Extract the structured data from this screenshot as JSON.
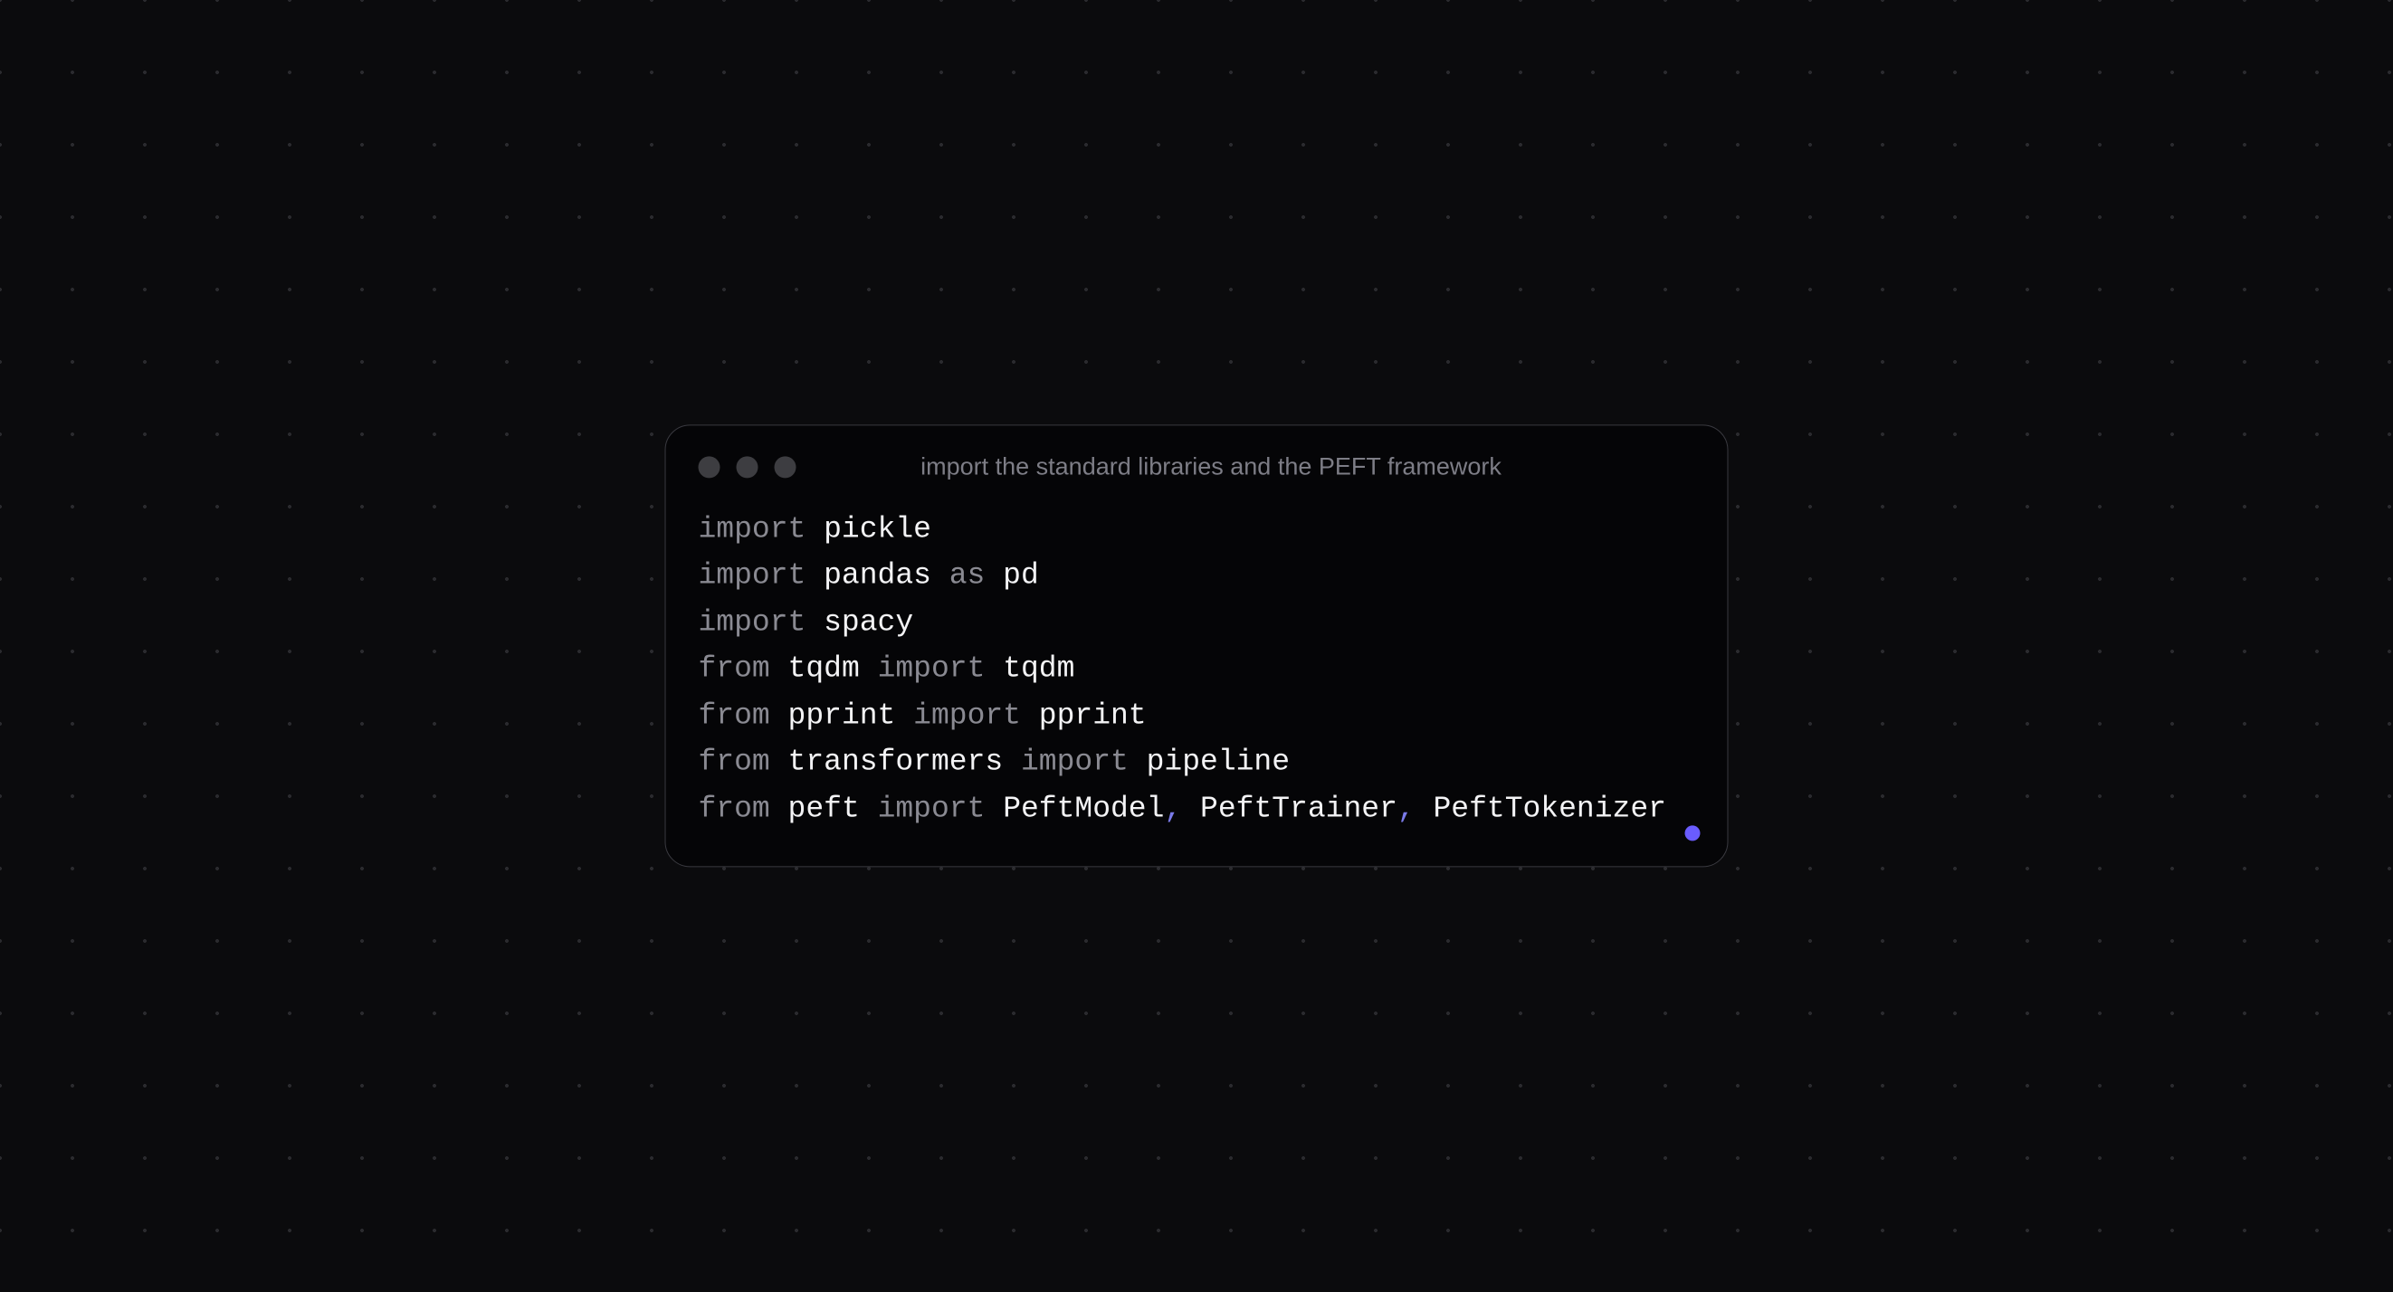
{
  "window": {
    "title": "import the standard libraries and the PEFT framework"
  },
  "code": {
    "lines": [
      [
        {
          "t": "import ",
          "c": "kw"
        },
        {
          "t": "pickle",
          "c": "id"
        }
      ],
      [
        {
          "t": "import ",
          "c": "kw"
        },
        {
          "t": "pandas ",
          "c": "id"
        },
        {
          "t": "as ",
          "c": "kw"
        },
        {
          "t": "pd",
          "c": "id"
        }
      ],
      [
        {
          "t": "import ",
          "c": "kw"
        },
        {
          "t": "spacy",
          "c": "id"
        }
      ],
      [
        {
          "t": "from ",
          "c": "kw"
        },
        {
          "t": "tqdm ",
          "c": "id"
        },
        {
          "t": "import ",
          "c": "kw"
        },
        {
          "t": "tqdm",
          "c": "id"
        }
      ],
      [
        {
          "t": "from ",
          "c": "kw"
        },
        {
          "t": "pprint ",
          "c": "id"
        },
        {
          "t": "import ",
          "c": "kw"
        },
        {
          "t": "pprint",
          "c": "id"
        }
      ],
      [
        {
          "t": "from ",
          "c": "kw"
        },
        {
          "t": "transformers ",
          "c": "id"
        },
        {
          "t": "import ",
          "c": "kw"
        },
        {
          "t": "pipeline",
          "c": "id"
        }
      ],
      [
        {
          "t": "from ",
          "c": "kw"
        },
        {
          "t": "peft ",
          "c": "id"
        },
        {
          "t": "import ",
          "c": "kw"
        },
        {
          "t": "PeftModel",
          "c": "id"
        },
        {
          "t": ", ",
          "c": "punc"
        },
        {
          "t": "PeftTrainer",
          "c": "id"
        },
        {
          "t": ", ",
          "c": "punc"
        },
        {
          "t": "PeftTokenizer",
          "c": "id"
        }
      ]
    ]
  },
  "colors": {
    "keyword": "#8a8a92",
    "identifier": "#f3f3f5",
    "punctuation": "#7a7ae8",
    "accent": "#6a5cff",
    "window_border": "#3a3a40",
    "window_bg": "#050507",
    "backdrop": "#0b0b0d"
  }
}
